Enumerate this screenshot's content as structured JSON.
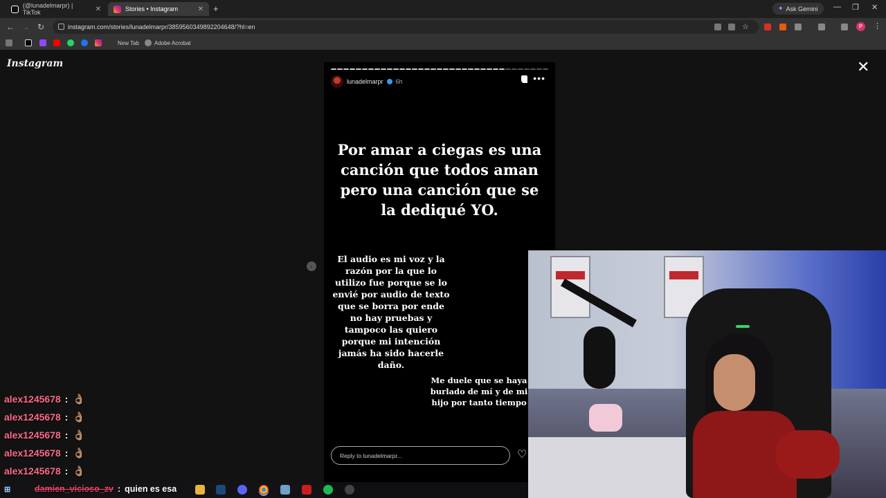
{
  "browser": {
    "tabs": [
      {
        "title": "(@lunadelmarpr) | TikTok",
        "active": false
      },
      {
        "title": "Stories • Instagram",
        "active": true
      }
    ],
    "new_tab_symbol": "+",
    "ask_gemini": "Ask Gemini",
    "url": "instagram.com/stories/lunadelmarpr/3859560349892204648/?hl=en",
    "profile_initial": "P",
    "bookmarks": [
      {
        "label": "New Tab"
      },
      {
        "label": "Adobe Acrobat"
      }
    ]
  },
  "instagram": {
    "logo": "Instagram",
    "close_symbol": "✕",
    "story": {
      "username": "lunadelmarpr",
      "time": "6h",
      "more": "•••",
      "headline": "Por amar a ciegas es una canción que todos aman pero una canción que se la dediqué YO.",
      "body1": "El audio es mi voz y la razón por la que lo utilizo fue porque se lo envié por audio de texto que se borra por ende no hay pruebas y tampoco las quiero porque mi intención jamás ha sido hacerle daño.",
      "body2": "Me duele que se haya burlado de mí y de mi hijo por tanto tiempo",
      "reply_placeholder": "Reply to lunadelmarpr...",
      "heart": "♡",
      "prev": "‹"
    }
  },
  "stream_chat": {
    "lines": [
      {
        "user": "alex1245678",
        "sep": ":",
        "emoji": "👌🏽"
      },
      {
        "user": "alex1245678",
        "sep": ":",
        "emoji": "👌🏽"
      },
      {
        "user": "alex1245678",
        "sep": ":",
        "emoji": "👌🏽"
      },
      {
        "user": "alex1245678",
        "sep": ":",
        "emoji": "👌🏽"
      },
      {
        "user": "alex1245678",
        "sep": ":",
        "emoji": "👌🏽"
      }
    ],
    "bottom": {
      "user": "damien_vicioso_zv",
      "sep": ":",
      "message": "quien es esa"
    }
  },
  "colors": {
    "chat_user": "#ff6b8a",
    "instagram_icon": "#e1306c",
    "verified": "#3897f0"
  }
}
